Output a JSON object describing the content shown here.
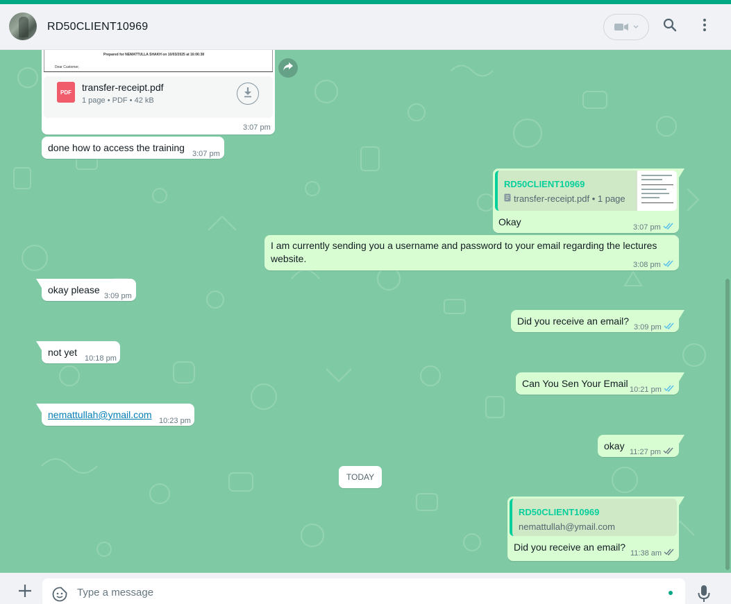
{
  "header": {
    "contact_name": "RD50CLIENT10969"
  },
  "messages": {
    "pdf": {
      "preview_prepared": "Prepared for NEMATTULLA SHAKH on 10/03/2025 at 16:06:38",
      "preview_greeting": "Dear Customer,",
      "file_name": "transfer-receipt.pdf",
      "file_info": "1 page • PDF • 42 kB",
      "badge": "PDF",
      "time": "3:07 pm"
    },
    "m1": {
      "text": "done how to access the training",
      "time": "3:07 pm"
    },
    "m2": {
      "quote_author": "RD50CLIENT10969",
      "quote_text": "transfer-receipt.pdf • 1 page",
      "text": "Okay",
      "time": "3:07 pm"
    },
    "m3": {
      "line1": "I am currently sending you a username and password to your email regarding the lectures",
      "line2": "website.",
      "time": "3:08 pm"
    },
    "m4": {
      "text": "okay please",
      "time": "3:09 pm"
    },
    "m5": {
      "text": "Did you receive an email?",
      "time": "3:09 pm"
    },
    "m6": {
      "text": "not yet",
      "time": "10:18 pm"
    },
    "m7": {
      "text": "Can You Sen Your Email",
      "time": "10:21 pm"
    },
    "m8": {
      "text": "nemattullah@ymail.com",
      "time": "10:23 pm"
    },
    "m9": {
      "text": "okay",
      "time": "11:27 pm"
    },
    "date_divider": "TODAY",
    "m10": {
      "quote_author": "RD50CLIENT10969",
      "quote_text": "nemattullah@ymail.com",
      "text": "Did you receive an email?",
      "time": "11:38 am"
    }
  },
  "composer": {
    "placeholder": "Type a message"
  },
  "colors": {
    "accent": "#00a884",
    "chat_background": "#7fcaa5",
    "outgoing_bubble": "#d9fdd3",
    "incoming_bubble": "#ffffff",
    "read_tick": "#53bdeb",
    "sent_tick": "#667781",
    "quote_author": "#06cf9c"
  },
  "icons": {
    "header": [
      "video-call-icon",
      "chevron-down-icon",
      "search-icon",
      "menu-dots-icon"
    ],
    "composer": [
      "plus-icon",
      "sticker-icon",
      "mic-icon"
    ]
  }
}
